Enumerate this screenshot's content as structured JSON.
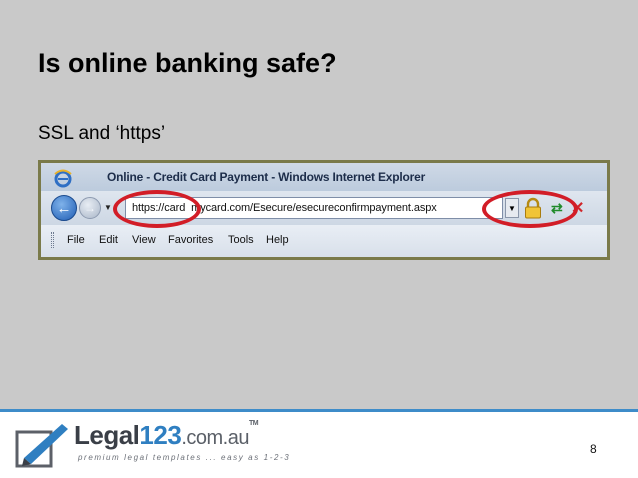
{
  "slide": {
    "title": "Is online banking safe?",
    "subtitle": "SSL and ‘https’",
    "page_number": "8"
  },
  "browser": {
    "window_title": "Online - Credit Card Payment - Windows Internet Explorer",
    "address": "https://card  mycard.com/Esecure/esecureconfirmpayment.aspx",
    "menu": [
      "File",
      "Edit",
      "View",
      "Favorites",
      "Tools",
      "Help"
    ],
    "icons": [
      "ie-logo-icon",
      "back-arrow-icon",
      "forward-arrow-icon",
      "lock-icon",
      "refresh-icon",
      "stop-icon"
    ]
  },
  "footer": {
    "brand_prefix": "Legal",
    "brand_number": "123",
    "brand_domain": ".com.au",
    "brand_tm": "TM",
    "tagline": "premium legal templates ... easy as 1-2-3"
  },
  "colors": {
    "background": "#c9c9c9",
    "highlight": "#d21d27",
    "footer_rule": "#3e8cc9",
    "brand_blue": "#2f7fc1"
  }
}
